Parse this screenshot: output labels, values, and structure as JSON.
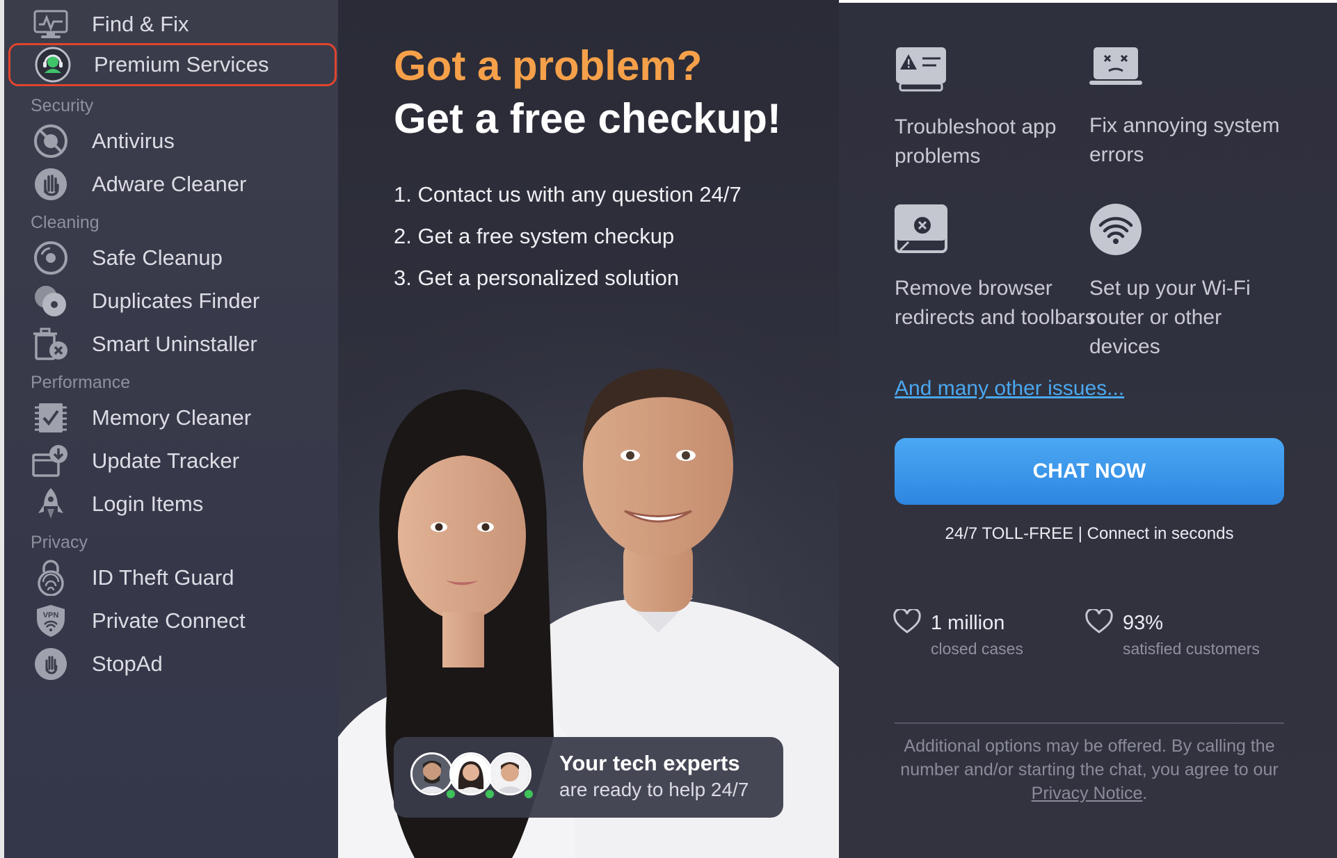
{
  "sidebar": {
    "items": [
      {
        "label": "Find & Fix",
        "icon": "monitor-icon"
      },
      {
        "label": "Premium Services",
        "icon": "headset-icon",
        "selected": true
      },
      {
        "label": "Antivirus",
        "icon": "virus-shield-icon"
      },
      {
        "label": "Adware Cleaner",
        "icon": "hand-stop-icon"
      },
      {
        "label": "Safe Cleanup",
        "icon": "disk-cleanup-icon"
      },
      {
        "label": "Duplicates Finder",
        "icon": "duplicate-discs-icon"
      },
      {
        "label": "Smart Uninstaller",
        "icon": "trash-x-icon"
      },
      {
        "label": "Memory Cleaner",
        "icon": "memory-chip-icon"
      },
      {
        "label": "Update Tracker",
        "icon": "download-box-icon"
      },
      {
        "label": "Login Items",
        "icon": "rocket-icon"
      },
      {
        "label": "ID Theft Guard",
        "icon": "fingerprint-lock-icon"
      },
      {
        "label": "Private Connect",
        "icon": "vpn-shield-icon"
      },
      {
        "label": "StopAd",
        "icon": "hand-circle-icon"
      }
    ],
    "sections": {
      "security": "Security",
      "cleaning": "Cleaning",
      "performance": "Performance",
      "privacy": "Privacy"
    },
    "selected_border_color": "#e0452f"
  },
  "promo": {
    "headline_1": "Got a problem?",
    "headline_2": "Get a free checkup!",
    "headline_1_color": "#f6a04a",
    "steps": [
      "1. Contact us with any question 24/7",
      "2. Get a free system checkup",
      "3. Get a personalized solution"
    ],
    "experts": {
      "title": "Your tech experts",
      "subtitle": "are ready to help 24/7"
    }
  },
  "right": {
    "features": [
      {
        "text": "Troubleshoot app problems",
        "icon": "app-warning-icon"
      },
      {
        "text": "Fix annoying system errors",
        "icon": "sad-laptop-icon"
      },
      {
        "text": "Remove browser redirects and toolbars",
        "icon": "browser-close-icon"
      },
      {
        "text": "Set up your Wi-Fi router or other devices",
        "icon": "wifi-icon"
      }
    ],
    "more_link": "And many other issues...",
    "chat_button": "CHAT NOW",
    "tollfree": "24/7 TOLL-FREE | Connect in seconds",
    "stats": [
      {
        "value": "1 million",
        "label": "closed cases"
      },
      {
        "value": "93%",
        "label": "satisfied customers"
      }
    ],
    "disclaimer_pre": "Additional options may be offered. By calling the number and/or starting the chat, you agree to our ",
    "privacy_link": "Privacy Notice",
    "disclaimer_post": ".",
    "accent_color": "#2e86e0"
  }
}
